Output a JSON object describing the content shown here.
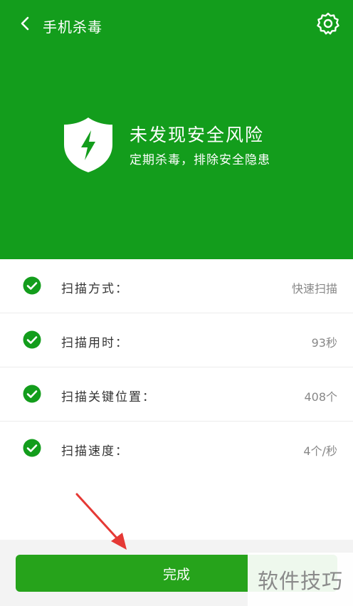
{
  "header": {
    "title": "手机杀毒",
    "status_title": "未发现安全风险",
    "status_subtitle": "定期杀毒，排除安全隐患"
  },
  "scan_results": [
    {
      "label": "扫描方式：",
      "value": "快速扫描"
    },
    {
      "label": "扫描用时：",
      "value": "93秒"
    },
    {
      "label": "扫描关键位置：",
      "value": "408个"
    },
    {
      "label": "扫描速度：",
      "value": "4个/秒"
    }
  ],
  "actions": {
    "done_label": "完成"
  },
  "watermark": {
    "text": "软件技巧"
  },
  "colors": {
    "brand_green": "#139d1c",
    "button_green": "#26a31b",
    "annotation_red": "#e53935"
  },
  "icons": [
    "back-arrow-icon",
    "gear-icon",
    "shield-lightning-icon",
    "check-circle-icon"
  ]
}
